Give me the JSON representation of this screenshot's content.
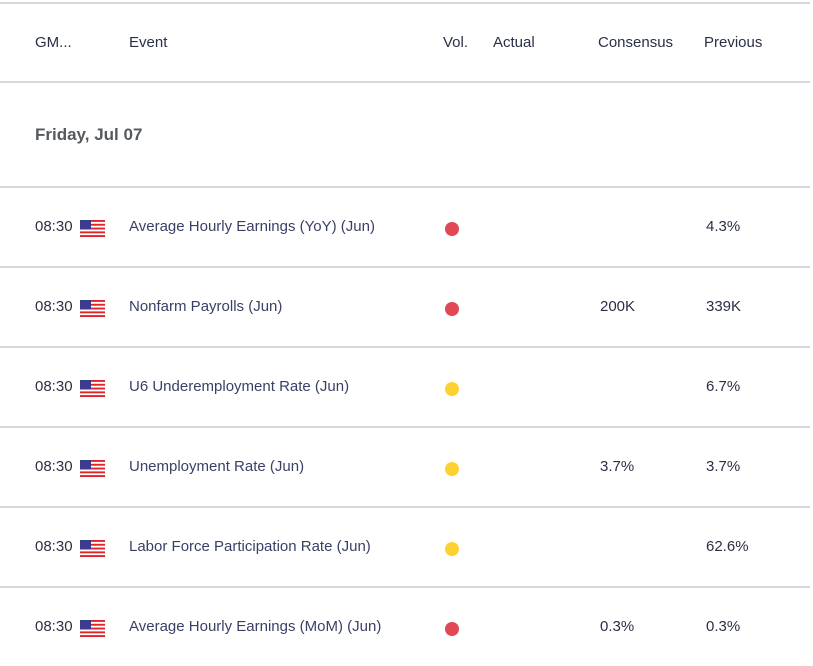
{
  "header": {
    "columns": [
      "GM...",
      "Event",
      "Vol.",
      "Actual",
      "Consensus",
      "Previous"
    ]
  },
  "date_label": "Friday, Jul 07",
  "volatility_colors": {
    "high": "#e04855",
    "medium": "#fdd22f"
  },
  "events": [
    {
      "time": "08:30",
      "country": "us-flag-icon",
      "event": "Average Hourly Earnings (YoY) (Jun)",
      "volatility": "high",
      "actual": "",
      "consensus": "",
      "previous": "4.3%"
    },
    {
      "time": "08:30",
      "country": "us-flag-icon",
      "event": "Nonfarm Payrolls (Jun)",
      "volatility": "high",
      "actual": "",
      "consensus": "200K",
      "previous": "339K"
    },
    {
      "time": "08:30",
      "country": "us-flag-icon",
      "event": "U6 Underemployment Rate (Jun)",
      "volatility": "medium",
      "actual": "",
      "consensus": "",
      "previous": "6.7%"
    },
    {
      "time": "08:30",
      "country": "us-flag-icon",
      "event": "Unemployment Rate (Jun)",
      "volatility": "medium",
      "actual": "",
      "consensus": "3.7%",
      "previous": "3.7%"
    },
    {
      "time": "08:30",
      "country": "us-flag-icon",
      "event": "Labor Force Participation Rate (Jun)",
      "volatility": "medium",
      "actual": "",
      "consensus": "",
      "previous": "62.6%"
    },
    {
      "time": "08:30",
      "country": "us-flag-icon",
      "event": "Average Hourly Earnings (MoM) (Jun)",
      "volatility": "high",
      "actual": "",
      "consensus": "0.3%",
      "previous": "0.3%"
    }
  ]
}
